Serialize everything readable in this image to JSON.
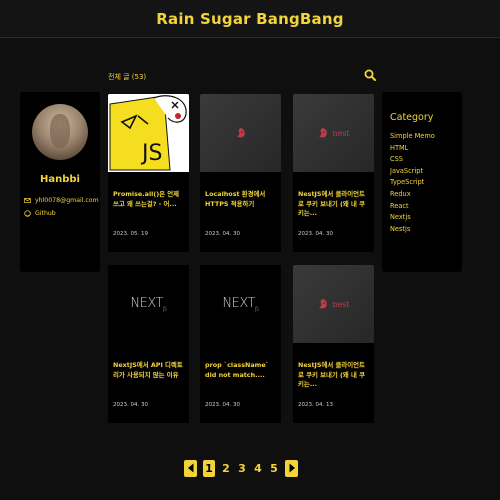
{
  "site": {
    "title": "Rain Sugar BangBang"
  },
  "profile": {
    "name": "Hanbbi",
    "links": [
      {
        "icon": "mail-icon",
        "label": "yhl0078@gmail.com"
      },
      {
        "icon": "github-icon",
        "label": "Github"
      }
    ]
  },
  "posts_header": {
    "count_label": "전체 글 (53)",
    "search_icon": "search-icon"
  },
  "posts": [
    {
      "thumb": "js",
      "title": "Promise.all()은 언제 쓰고 왜 쓰는걸? - 어...",
      "date": "2023. 05. 19"
    },
    {
      "thumb": "nest",
      "title": "Localhost 환경에서 HTTPS 적용하기",
      "date": "2023. 04. 30"
    },
    {
      "thumb": "nest",
      "title": "NestJS에서 클라이언트로 쿠키 보내기 (왜 내 쿠키는...",
      "date": "2023. 04. 30"
    },
    {
      "thumb": "next",
      "title": "NextJS에서 API 디렉토리가 사용되지 않는 이유",
      "date": "2023. 04. 30"
    },
    {
      "thumb": "next",
      "title": "prop `className` did not match....",
      "date": "2023. 04. 30"
    },
    {
      "thumb": "nest",
      "title": "NestJS에서 클라이언트로 쿠키 보내기 (왜 내 쿠키는...",
      "date": "2023. 04. 13"
    }
  ],
  "thumb_text": {
    "nest": "nest",
    "next": "NEXT",
    "next_sub": "JS",
    "js": "JS"
  },
  "category": {
    "title": "Category",
    "items": [
      "Simple Memo",
      "HTML",
      "CSS",
      "JavaScript",
      "TypeScript",
      "Redux",
      "React",
      "Nextjs",
      "Nestjs"
    ]
  },
  "pagination": {
    "pages": [
      "1",
      "2",
      "3",
      "4",
      "5"
    ],
    "current": "1"
  },
  "colors": {
    "accent": "#f2d43a",
    "background": "#0f0f0f",
    "card": "#000000",
    "nest_red": "#c23b4b"
  }
}
